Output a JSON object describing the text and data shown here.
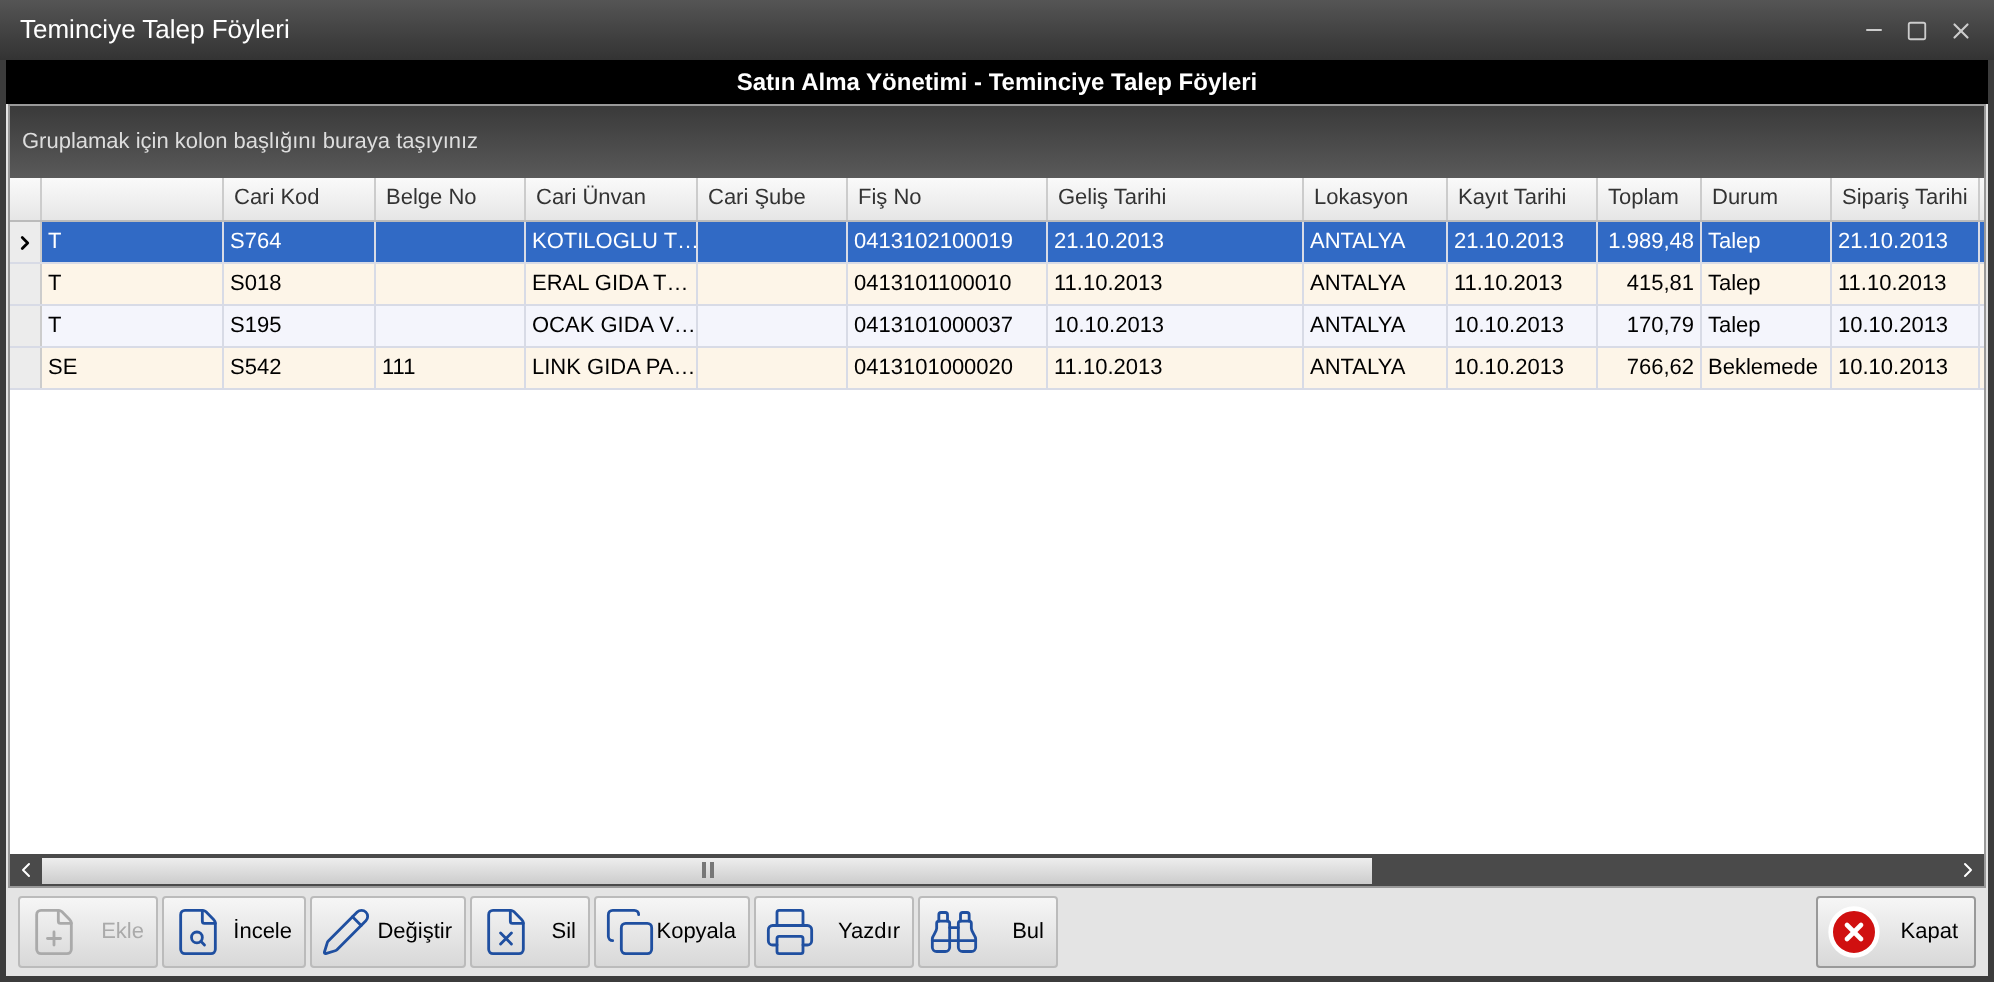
{
  "window": {
    "title": "Teminciye Talep Föyleri"
  },
  "header": "Satın Alma Yönetimi - Teminciye Talep Föyleri",
  "group_panel": {
    "hint": "Gruplamak için kolon başlığını buraya taşıyınız"
  },
  "table": {
    "columns": [
      {
        "kind": "text"
      },
      {
        "label": "Cari Kod",
        "kind": "text"
      },
      {
        "label": "Belge No",
        "kind": "text"
      },
      {
        "label": "Cari Ünvan",
        "kind": "text"
      },
      {
        "label": "Cari Şube",
        "kind": "text"
      },
      {
        "label": "Fiş No",
        "kind": "text"
      },
      {
        "label": "Geliş Tarihi",
        "kind": "text"
      },
      {
        "label": "Lokasyon",
        "kind": "text"
      },
      {
        "label": "Kayıt Tarihi",
        "kind": "text"
      },
      {
        "label": "Toplam",
        "kind": "number"
      },
      {
        "label": "Durum",
        "kind": "text"
      },
      {
        "label": "Sipariş Tarihi",
        "kind": "text"
      }
    ],
    "rows": [
      {
        "selected": true,
        "cells": [
          "T",
          "S764",
          "",
          "KOTILOGLU T…",
          "",
          "0413102100019",
          "21.10.2013",
          "ANTALYA",
          "21.10.2013",
          "1.989,48",
          "Talep",
          "21.10.2013"
        ]
      },
      {
        "selected": false,
        "cells": [
          "T",
          "S018",
          "",
          "ERAL GIDA T…",
          "",
          "0413101100010",
          "11.10.2013",
          "ANTALYA",
          "11.10.2013",
          "415,81",
          "Talep",
          "11.10.2013"
        ]
      },
      {
        "selected": false,
        "cells": [
          "T",
          "S195",
          "",
          "OCAK GIDA V…",
          "",
          "0413101000037",
          "10.10.2013",
          "ANTALYA",
          "10.10.2013",
          "170,79",
          "Talep",
          "10.10.2013"
        ]
      },
      {
        "selected": false,
        "cells": [
          "SE",
          "S542",
          "111",
          "LINK GIDA PA…",
          "",
          "0413101000020",
          "11.10.2013",
          "ANTALYA",
          "10.10.2013",
          "766,62",
          "Beklemede",
          "10.10.2013"
        ]
      }
    ]
  },
  "toolbar": [
    {
      "label": "Ekle",
      "kind": "add",
      "disabled": true
    },
    {
      "label": "İncele",
      "kind": "view",
      "disabled": false
    },
    {
      "label": "Değiştir",
      "kind": "edit",
      "disabled": false
    },
    {
      "label": "Sil",
      "kind": "delete",
      "disabled": false
    },
    {
      "label": "Kopyala",
      "kind": "copy",
      "disabled": false
    },
    {
      "label": "Yazdır",
      "kind": "print",
      "disabled": false
    },
    {
      "label": "Bul",
      "kind": "find",
      "disabled": false
    }
  ],
  "close_button": {
    "label": "Kapat"
  }
}
